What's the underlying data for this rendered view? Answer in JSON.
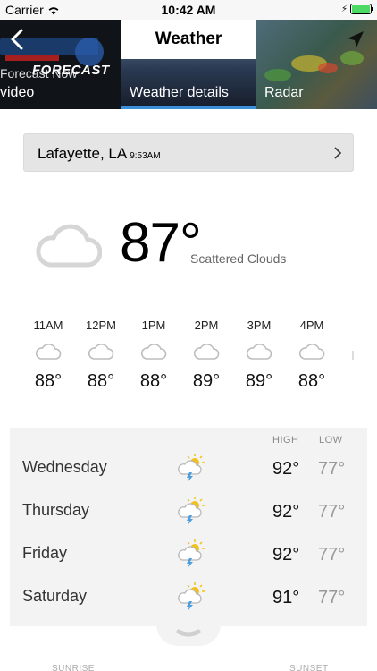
{
  "status_bar": {
    "carrier": "Carrier",
    "time": "10:42 AM"
  },
  "nav": {
    "title": "Weather"
  },
  "tabs": [
    {
      "label": "video",
      "overlay_title": "FORECAST",
      "overlay_sub": "Forecast Now"
    },
    {
      "label": "Weather details",
      "selected": true
    },
    {
      "label": "Radar"
    }
  ],
  "location": {
    "city": "Lafayette, LA",
    "time": "9:53AM"
  },
  "current": {
    "temp": "87°",
    "condition": "Scattered Clouds",
    "icon": "cloud-icon"
  },
  "hourly": [
    {
      "time": "11AM",
      "temp": "88°",
      "icon": "cloud-icon"
    },
    {
      "time": "12PM",
      "temp": "88°",
      "icon": "cloud-icon"
    },
    {
      "time": "1PM",
      "temp": "88°",
      "icon": "cloud-icon"
    },
    {
      "time": "2PM",
      "temp": "89°",
      "icon": "cloud-icon"
    },
    {
      "time": "3PM",
      "temp": "89°",
      "icon": "cloud-icon"
    },
    {
      "time": "4PM",
      "temp": "88°",
      "icon": "cloud-icon"
    }
  ],
  "daily": {
    "high_label": "HIGH",
    "low_label": "LOW",
    "days": [
      {
        "name": "Wednesday",
        "high": "92°",
        "low": "77°",
        "icon": "thunderstorm-sun-icon"
      },
      {
        "name": "Thursday",
        "high": "92°",
        "low": "77°",
        "icon": "thunderstorm-sun-icon"
      },
      {
        "name": "Friday",
        "high": "92°",
        "low": "77°",
        "icon": "thunderstorm-sun-icon"
      },
      {
        "name": "Saturday",
        "high": "91°",
        "low": "77°",
        "icon": "thunderstorm-sun-icon"
      }
    ]
  },
  "footer": {
    "sunrise_label": "SUNRISE",
    "sunset_label": "SUNSET"
  },
  "colors": {
    "accent": "#3b8fd9",
    "battery": "#4cd964",
    "panel": "#f3f3f3",
    "location_bar": "#e5e5e5"
  }
}
